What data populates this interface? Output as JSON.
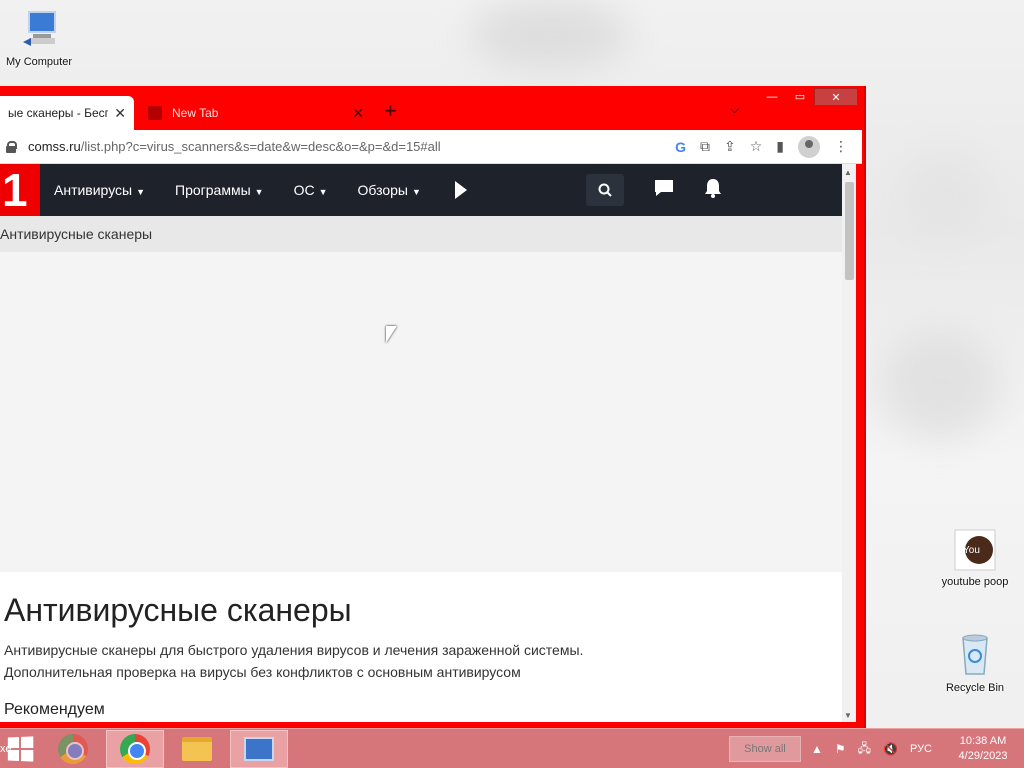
{
  "desktop": {
    "icons": [
      {
        "label": "My Computer",
        "icon": "computer-icon"
      },
      {
        "label": "youtube poop",
        "icon": "youtube-icon"
      },
      {
        "label": "Recycle Bin",
        "icon": "recycle-bin-icon"
      }
    ]
  },
  "browser": {
    "tabs": [
      {
        "label": "ые сканеры - Беспл",
        "active": true
      },
      {
        "label": "New Tab",
        "active": false
      }
    ],
    "new_tab": "+",
    "tab_menu": "⌄",
    "url_host": "comss.ru",
    "url_path": "/list.php?c=virus_scanners&s=date&w=desc&o=&p=&d=15#all"
  },
  "site": {
    "logo": "1",
    "nav": [
      {
        "label": "Антивирусы"
      },
      {
        "label": "Программы"
      },
      {
        "label": "ОС"
      },
      {
        "label": "Обзоры"
      }
    ],
    "breadcrumb": "Антивирусные сканеры",
    "title": "Антивирусные сканеры",
    "description_1": "Антивирусные сканеры для быстрого удаления вирусов и лечения зараженной системы.",
    "description_2": "Дополнительная проверка на вирусы без конфликтов с основным антивирусом",
    "recommend": "Рекомендуем"
  },
  "taskbar": {
    "show_all": "Show all",
    "language": "РУС",
    "time": "10:38 AM",
    "date": "4/29/2023",
    "left_fragment": "xe"
  },
  "colors": {
    "window_accent": "#ff0000",
    "site_nav": "#1e232b",
    "taskbar": "#d6757a"
  }
}
